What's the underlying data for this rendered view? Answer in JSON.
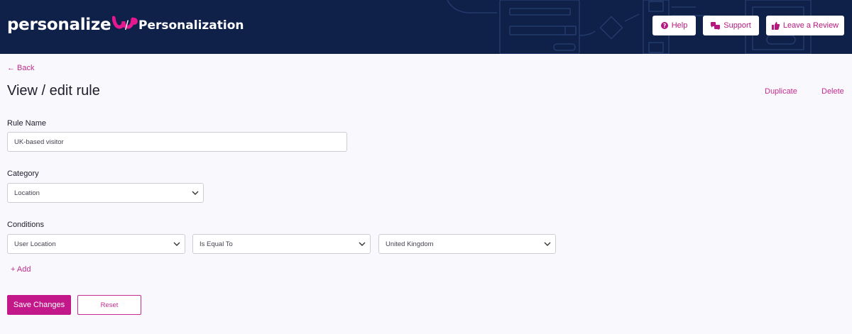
{
  "header": {
    "brand_name": "personalize",
    "breadcrumb_separator": "/",
    "breadcrumb_page": "Personalization",
    "help_label": "Help",
    "support_label": "Support",
    "review_label": "Leave a Review",
    "background_color": "#0f2049",
    "accent_color": "#c2188a"
  },
  "nav": {
    "back_label": "← Back"
  },
  "page": {
    "title": "View / edit rule",
    "duplicate_label": "Duplicate",
    "delete_label": "Delete"
  },
  "form": {
    "rule_name_label": "Rule Name",
    "rule_name_value": "UK-based visitor",
    "category_label": "Category",
    "category_value": "Location",
    "conditions_label": "Conditions",
    "conditions": [
      {
        "field": "User Location",
        "operator": "Is Equal To",
        "value": "United Kingdom"
      }
    ],
    "add_label": "+ Add"
  },
  "actions": {
    "save_label": "Save Changes",
    "reset_label": "Reset"
  },
  "icons": {
    "help": "question-circle-icon",
    "support": "chat-bubbles-icon",
    "review": "thumbs-up-icon",
    "dropdown": "chevron-down-icon"
  }
}
